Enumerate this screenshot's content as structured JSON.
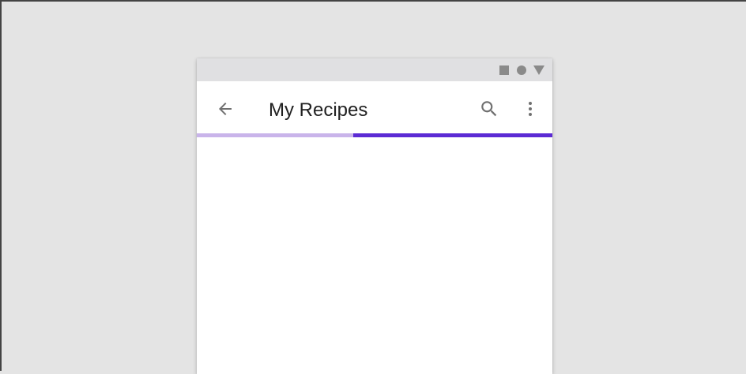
{
  "app_bar": {
    "title": "My Recipes",
    "back_icon": "arrow-back-icon",
    "search_icon": "search-icon",
    "more_icon": "more-vert-icon"
  },
  "status_bar": {
    "icons": [
      "square-icon",
      "circle-icon",
      "triangle-icon"
    ],
    "background": "#e0e0e2",
    "icon_color": "#8a8a8a"
  },
  "progress": {
    "value": 0.44,
    "fill_color": "#c9b4ea",
    "track_color": "#5c2bd4"
  },
  "colors": {
    "background": "#e4e4e4",
    "surface": "#ffffff",
    "title_text": "#212121",
    "icon": "#707070"
  }
}
